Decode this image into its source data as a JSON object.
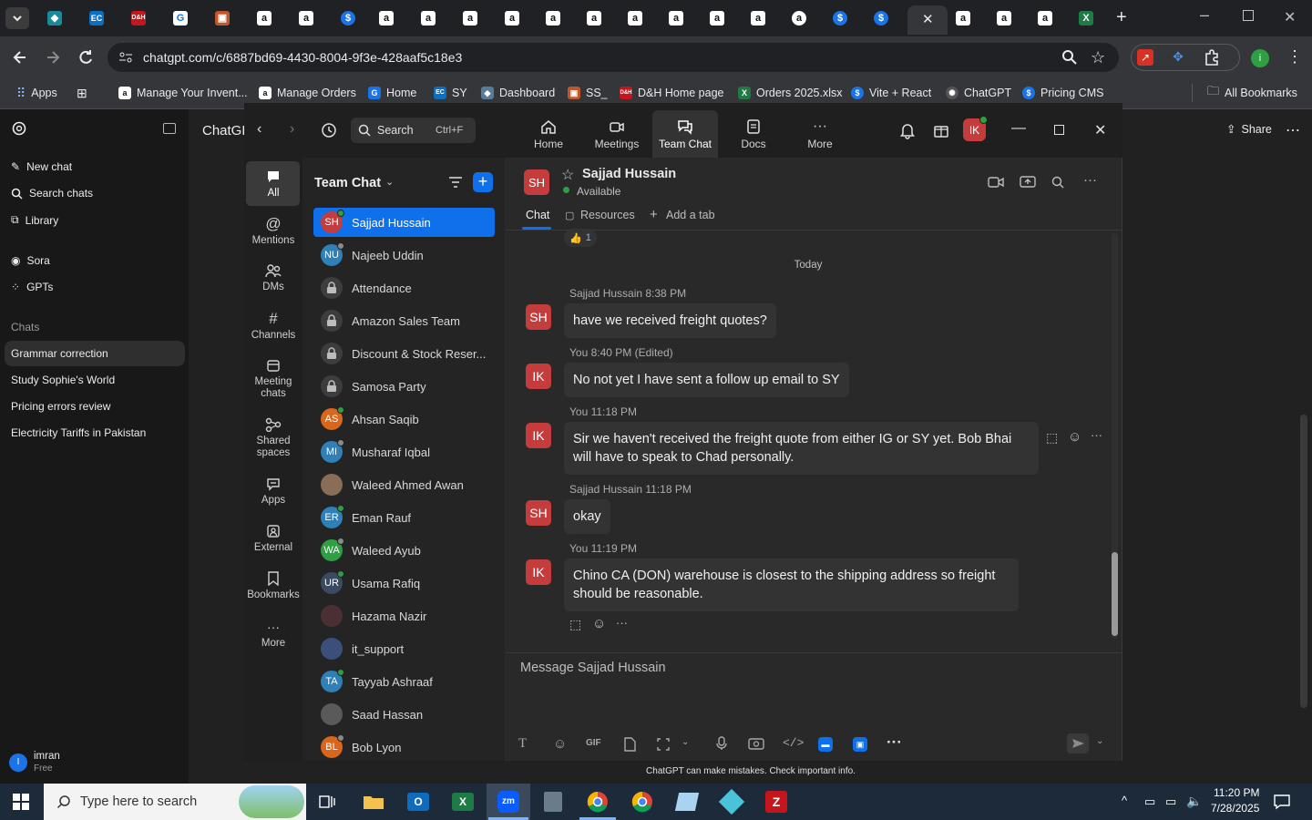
{
  "browser": {
    "url": "chatgpt.com/c/6887bd69-4430-8004-9f3e-428aaf5c18e3",
    "bookmarks": [
      {
        "label": "Apps"
      },
      {
        "label": "Manage Your Invent..."
      },
      {
        "label": "Manage Orders"
      },
      {
        "label": "Home"
      },
      {
        "label": "SY"
      },
      {
        "label": "Dashboard"
      },
      {
        "label": "SS_"
      },
      {
        "label": "D&H Home page"
      },
      {
        "label": "Orders 2025.xlsx"
      },
      {
        "label": "Vite + React"
      },
      {
        "label": "ChatGPT"
      },
      {
        "label": "Pricing CMS"
      }
    ],
    "all_bookmarks": "All Bookmarks"
  },
  "chatgpt": {
    "title": "ChatGP",
    "nav": {
      "new_chat": "New chat",
      "search": "Search chats",
      "library": "Library",
      "sora": "Sora",
      "gpts": "GPTs"
    },
    "chats_heading": "Chats",
    "chats": [
      "Grammar correction",
      "Study Sophie's World",
      "Pricing errors review",
      "Electricity Tariffs in Pakistan"
    ],
    "user": {
      "name": "imran",
      "plan": "Free",
      "initial": "I"
    },
    "share": "Share",
    "disclaimer": "ChatGPT can make mistakes. Check important info."
  },
  "teams": {
    "search": {
      "label": "Search",
      "shortcut": "Ctrl+F"
    },
    "top_nav": [
      "Home",
      "Meetings",
      "Team Chat",
      "Docs",
      "More"
    ],
    "self_initials": "IK",
    "rail": [
      "All",
      "Mentions",
      "DMs",
      "Channels",
      "Meeting chats",
      "Shared spaces",
      "Apps",
      "External",
      "Bookmarks",
      "More"
    ],
    "list_title": "Team Chat",
    "contacts": [
      {
        "initials": "SH",
        "name": "Sajjad Hussain",
        "color": "#c43c3c",
        "type": "avatar"
      },
      {
        "initials": "NU",
        "name": "Najeeb Uddin",
        "color": "#2f7fb8",
        "type": "avatar"
      },
      {
        "initials": "",
        "name": "Attendance",
        "color": "",
        "type": "lock"
      },
      {
        "initials": "",
        "name": "Amazon Sales Team",
        "color": "",
        "type": "lock"
      },
      {
        "initials": "",
        "name": "Discount & Stock Reser...",
        "color": "",
        "type": "lock"
      },
      {
        "initials": "",
        "name": "Samosa Party",
        "color": "",
        "type": "lock"
      },
      {
        "initials": "AS",
        "name": "Ahsan Saqib",
        "color": "#d9661a",
        "type": "avatar"
      },
      {
        "initials": "MI",
        "name": "Musharaf Iqbal",
        "color": "#2f7fb8",
        "type": "avatar"
      },
      {
        "initials": "",
        "name": "Waleed Ahmed Awan",
        "color": "#8a6d57",
        "type": "photo"
      },
      {
        "initials": "ER",
        "name": "Eman Rauf",
        "color": "#2f7fb8",
        "type": "avatar"
      },
      {
        "initials": "WA",
        "name": "Waleed Ayub",
        "color": "#2ea043",
        "type": "avatar"
      },
      {
        "initials": "UR",
        "name": "Usama Rafiq",
        "color": "#3a4a60",
        "type": "avatar"
      },
      {
        "initials": "",
        "name": "Hazama Nazir",
        "color": "#4a2f35",
        "type": "photo"
      },
      {
        "initials": "",
        "name": "it_support",
        "color": "#3b4f7a",
        "type": "photo"
      },
      {
        "initials": "TA",
        "name": "Tayyab Ashraaf",
        "color": "#2f7fb8",
        "type": "avatar"
      },
      {
        "initials": "",
        "name": "Saad Hassan",
        "color": "#5a5a5a",
        "type": "photo"
      },
      {
        "initials": "BL",
        "name": "Bob Lyon",
        "color": "#d9661a",
        "type": "avatar"
      }
    ],
    "chat": {
      "contact_initials": "SH",
      "contact_name": "Sajjad Hussain",
      "status": "Available",
      "tabs": [
        "Chat",
        "Resources",
        "Add a tab"
      ],
      "reaction_count": "1",
      "day_divider": "Today",
      "messages": [
        {
          "meta": "Sajjad Hussain 8:38 PM",
          "initials": "SH",
          "text": "have we received freight quotes?"
        },
        {
          "meta": "You 8:40 PM (Edited)",
          "initials": "IK",
          "text": "No not yet I have sent a follow up email to SY"
        },
        {
          "meta": "You 11:18 PM",
          "initials": "IK",
          "text": "Sir we haven't received the freight quote from either IG or SY yet. Bob Bhai will have to speak to Chad personally."
        },
        {
          "meta": "Sajjad Hussain 11:18 PM",
          "initials": "SH",
          "text": "okay"
        },
        {
          "meta": "You 11:19 PM",
          "initials": "IK",
          "text": "Chino CA (DON) warehouse is closest to the shipping address  so freight should be reasonable."
        }
      ],
      "compose_placeholder": "Message Sajjad Hussain",
      "gif_label": "GIF"
    }
  },
  "taskbar": {
    "search_placeholder": "Type here to search",
    "time": "11:20 PM",
    "date": "7/28/2025"
  },
  "colors": {
    "teams_accent": "#0e71eb",
    "self_avatar": "#c43c3c",
    "online": "#2ea043"
  }
}
